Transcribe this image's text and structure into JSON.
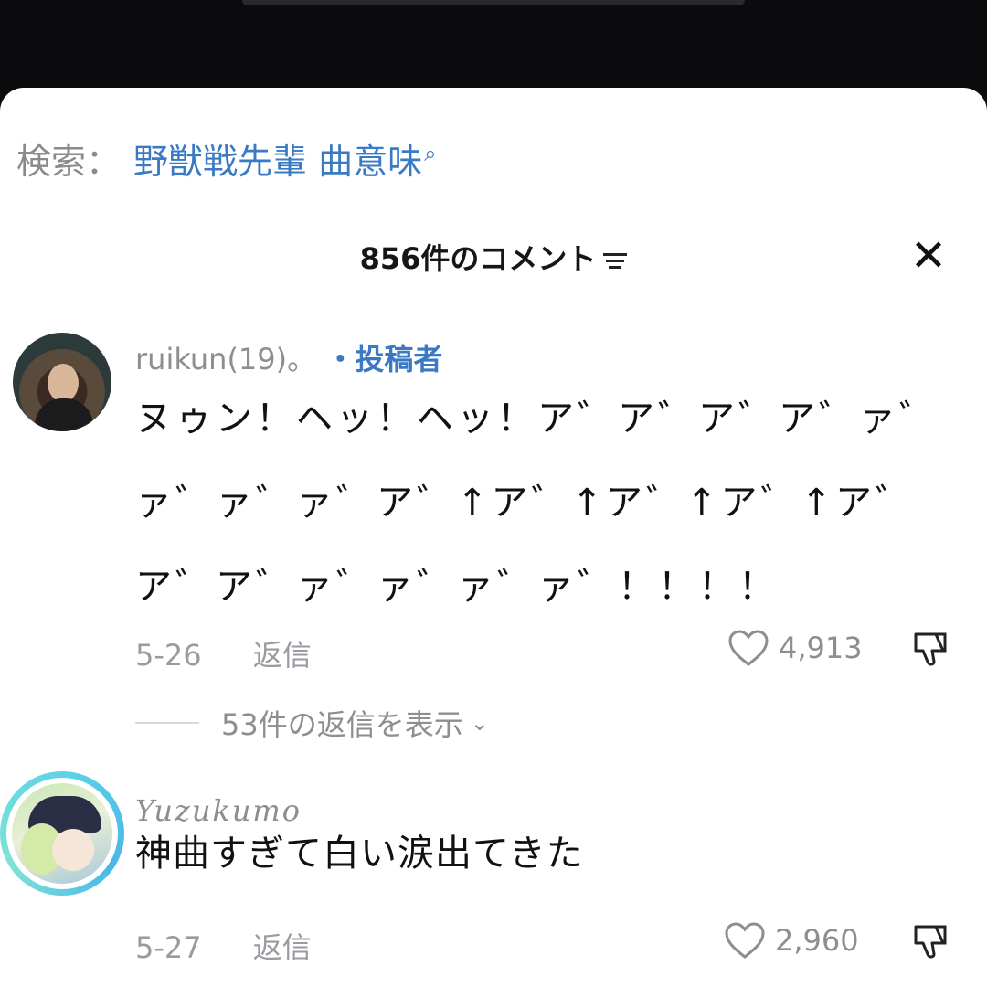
{
  "search": {
    "label": "検索：",
    "query": "野獣戦先輩 曲意味"
  },
  "header": {
    "title": "856件のコメント"
  },
  "comments": [
    {
      "username": "ruikun(19)。",
      "badge": "・投稿者",
      "lines": [
        "ヌゥン！ヘッ！ヘッ！ア゛ア゛ア゛ア゛ァ゛",
        "ァ゛ァ゛ァ゛ア゛↑ア゛↑ア゛↑ア゛↑ア゛",
        "ア゛ア゛ァ゛ァ゛ァ゛ァ゛！！！！"
      ],
      "date": "5-26",
      "reply_label": "返信",
      "likes": "4,913",
      "view_replies": "53件の返信を表示"
    },
    {
      "username": "Yuzukumo",
      "text": "神曲すぎて白い涙出てきた",
      "date": "5-27",
      "reply_label": "返信",
      "likes": "2,960"
    }
  ],
  "icons": {
    "search": "search-icon",
    "sort": "sort-icon",
    "close": "close-icon",
    "like": "heart-icon",
    "dislike": "thumbs-down-icon"
  },
  "colors": {
    "accent": "#3a79c4",
    "muted": "#8d8d92"
  }
}
